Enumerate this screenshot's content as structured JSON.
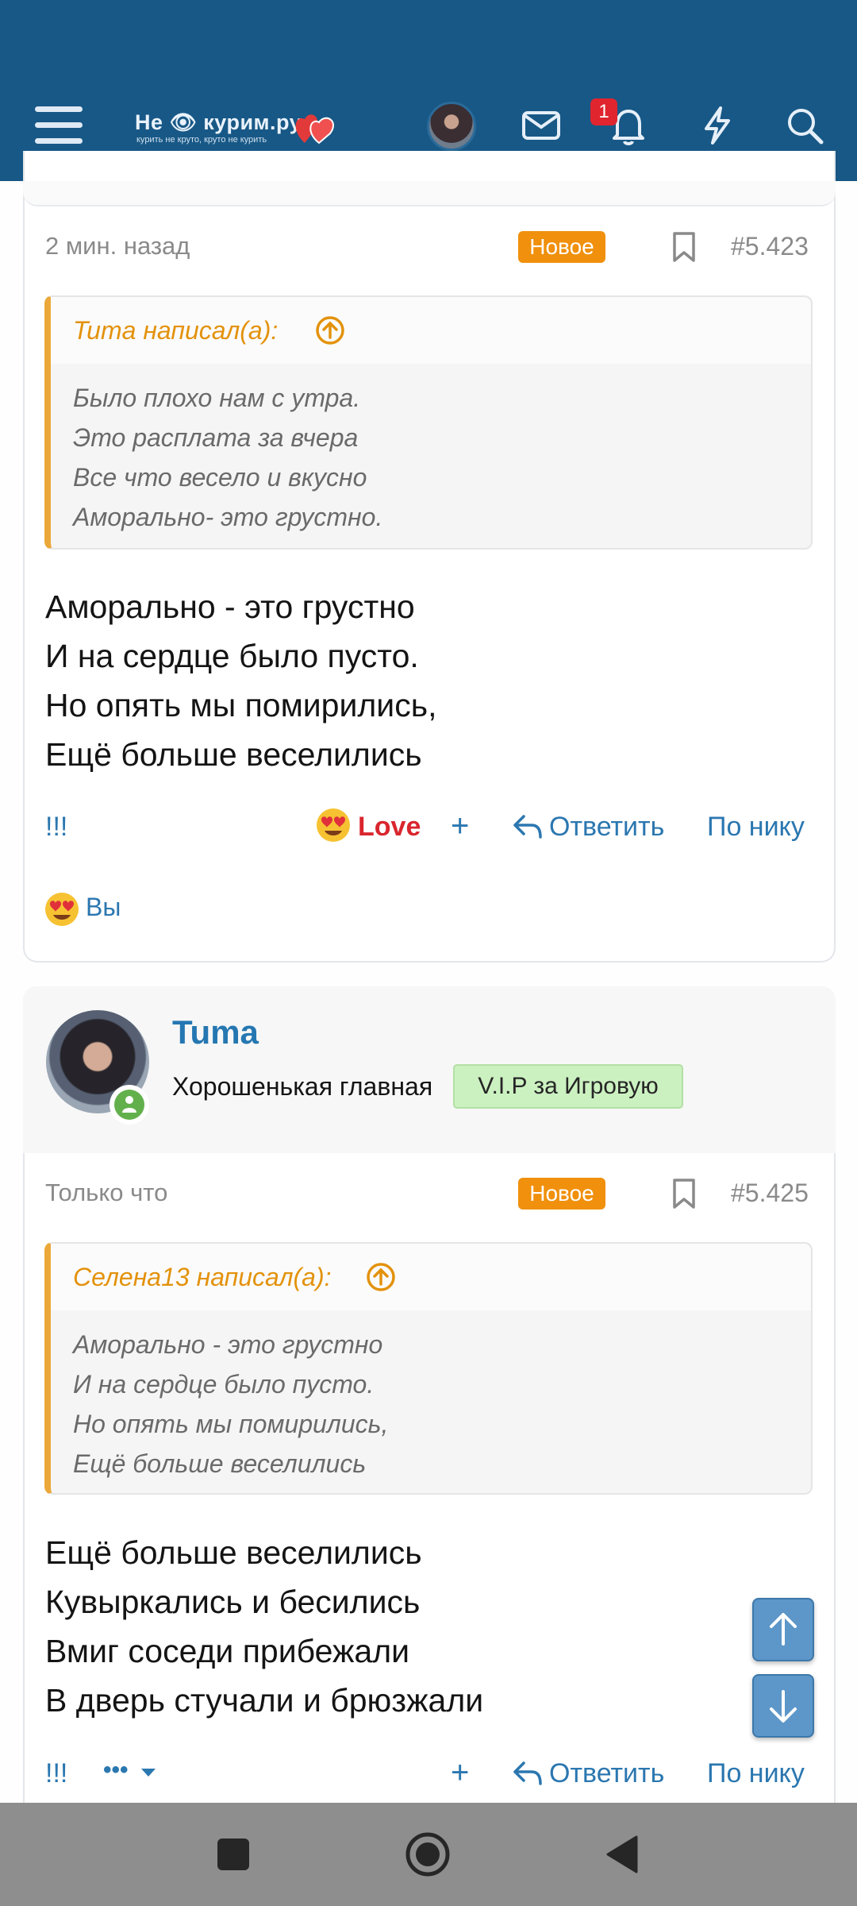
{
  "header": {
    "logo_text": "Не 👁 курим.ру",
    "logo_tagline": "курить не круто, круто не курить",
    "notification_count": "1",
    "icons": [
      "menu-icon",
      "avatar",
      "mail-icon",
      "bell-icon",
      "lightning-icon",
      "search-icon"
    ],
    "brand_color": "#185886"
  },
  "post1": {
    "time": "2 мин. назад",
    "new_label": "Новое",
    "number": "#5.423",
    "quote_author": "Tuma написал(а):",
    "quote_lines": [
      "Было плохо нам с утра.",
      "Это расплата за вчера",
      "Все что весело и вкусно",
      "Аморально- это грустно."
    ],
    "message_lines": [
      "Аморально - это грустно",
      "И на сердце было пусто.",
      "Но опять мы помирились,",
      "Ещё больше веселились"
    ],
    "actions": {
      "exclaim": "!!!",
      "reaction": "Love",
      "plus": "+",
      "reply": "Ответить",
      "by_nick": "По нику"
    },
    "reacted_by": "Вы"
  },
  "post2": {
    "author": "Tuma",
    "user_title": "Хорошенькая главная",
    "user_banner": "V.I.P за Игровую",
    "time": "Только что",
    "new_label": "Новое",
    "number": "#5.425",
    "quote_author": "Селена13 написал(а):",
    "quote_lines": [
      "Аморально - это грустно",
      "И на сердце было пусто.",
      "Но опять мы помирились,",
      "Ещё больше веселились"
    ],
    "message_lines": [
      "Ещё больше веселились",
      "Кувыркались и бесились",
      "Вмиг соседи прибежали",
      "В дверь стучали и брюзжали"
    ],
    "actions": {
      "exclaim": "!!!",
      "more": "•••",
      "plus": "+",
      "reply": "Ответить",
      "by_nick": "По нику"
    }
  },
  "colors": {
    "accent": "#2577b1",
    "new_badge": "#f0900c",
    "quote_border": "#eba83a",
    "love": "#d9262e",
    "online": "#62b04c"
  }
}
